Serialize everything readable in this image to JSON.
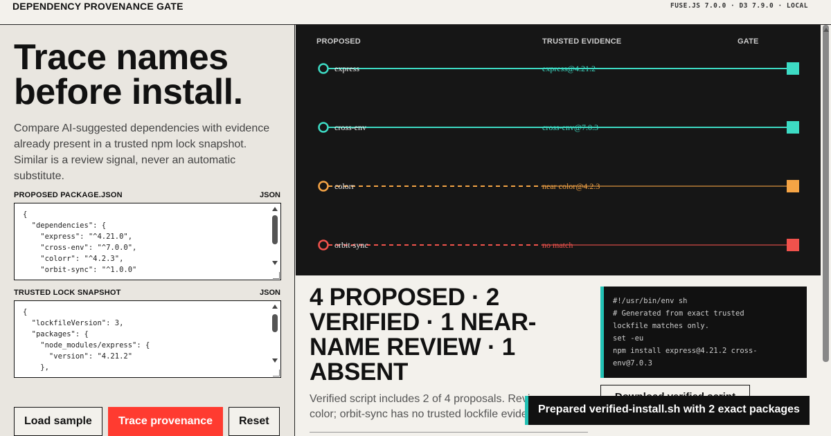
{
  "header": {
    "title": "DEPENDENCY PROVENANCE GATE",
    "versions": "FUSE.JS 7.0.0 · D3 7.9.0 · LOCAL"
  },
  "left": {
    "hero_line1": "Trace names",
    "hero_line2": "before install.",
    "intro": "Compare AI-suggested dependencies with evidence already present in a trusted npm lock snapshot. Similar is a review signal, never an automatic substitute.",
    "proposed": {
      "label": "PROPOSED PACKAGE.JSON",
      "format": "JSON",
      "content": "{\n  \"dependencies\": {\n    \"express\": \"^4.21.0\",\n    \"cross-env\": \"^7.0.0\",\n    \"colorr\": \"^4.2.3\",\n    \"orbit-sync\": \"^1.0.0\""
    },
    "lock": {
      "label": "TRUSTED LOCK SNAPSHOT",
      "format": "JSON",
      "content": "{\n  \"lockfileVersion\": 3,\n  \"packages\": {\n    \"node_modules/express\": {\n      \"version\": \"4.21.2\"\n    },"
    },
    "buttons": {
      "load": "Load sample",
      "trace": "Trace provenance",
      "reset": "Reset"
    }
  },
  "trace": {
    "headers": {
      "proposed": "PROPOSED",
      "evidence": "TRUSTED EVIDENCE",
      "gate": "GATE"
    },
    "colors": {
      "verified": "#3ddbc4",
      "review": "#f5a445",
      "absent": "#f0524c"
    },
    "rows": [
      {
        "name": "express",
        "evidence": "express@4.21.2",
        "status": "verified"
      },
      {
        "name": "cross-env",
        "evidence": "cross-env@7.0.3",
        "status": "verified"
      },
      {
        "name": "colorr",
        "evidence": "near color@4.2.3",
        "status": "review"
      },
      {
        "name": "orbit-sync",
        "evidence": "no match",
        "status": "absent"
      }
    ]
  },
  "summary": {
    "headline": "4 PROPOSED · 2 VERIFIED · 1 NEAR-NAME REVIEW · 1 ABSENT",
    "note": "Verified script includes 2 of 4 proposals. Review near color; orbit-sync has no trusted lockfile evidence."
  },
  "script": {
    "content": "#!/usr/bin/env sh\n# Generated from exact trusted\nlockfile matches only.\nset -eu\nnpm install express@4.21.2 cross-\nenv@7.0.3",
    "download_label": "Download verified script"
  },
  "toast": "Prepared verified-install.sh with 2 exact packages"
}
